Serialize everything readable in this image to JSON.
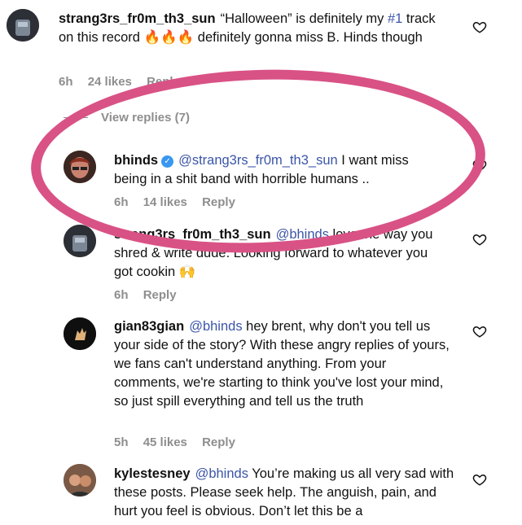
{
  "comments": [
    {
      "username": "strang3rs_fr0m_th3_sun",
      "text_parts": [
        "“Halloween” is definitely my ",
        "#1",
        " track on this record 🔥🔥🔥 definitely gonna miss B. Hinds though"
      ],
      "time": "6h",
      "likes": "24 likes",
      "reply": "Reply"
    },
    {
      "username": "bhinds",
      "verified": true,
      "mention": "@strang3rs_fr0m_th3_sun",
      "text": "I want miss being in a shit band with horrible humans ..",
      "time": "6h",
      "likes": "14 likes",
      "reply": "Reply"
    },
    {
      "username": "strang3rs_fr0m_th3_sun",
      "mention": "@bhinds",
      "text": "love the way you shred & write dude. Looking forward to whatever you got cookin 🙌",
      "time": "6h",
      "reply": "Reply"
    },
    {
      "username": "gian83gian",
      "mention": "@bhinds",
      "text": "hey brent, why don't you tell us your side of the story? With these angry replies of yours, we fans can't understand anything. From your comments, we're starting to think you've lost your mind, so just spill everything and tell us the truth",
      "time": "5h",
      "likes": "45 likes",
      "reply": "Reply"
    },
    {
      "username": "kylestesney",
      "mention": "@bhinds",
      "text": "You’re making us all very sad with these posts. Please seek help. The anguish, pain, and hurt you feel is obvious. Don’t let this be a"
    }
  ],
  "view_replies": "View replies (7)",
  "colors": {
    "mention": "#3b55a8",
    "meta": "#8e8e8e",
    "highlight": "#d95285",
    "verified": "#3897f0"
  }
}
